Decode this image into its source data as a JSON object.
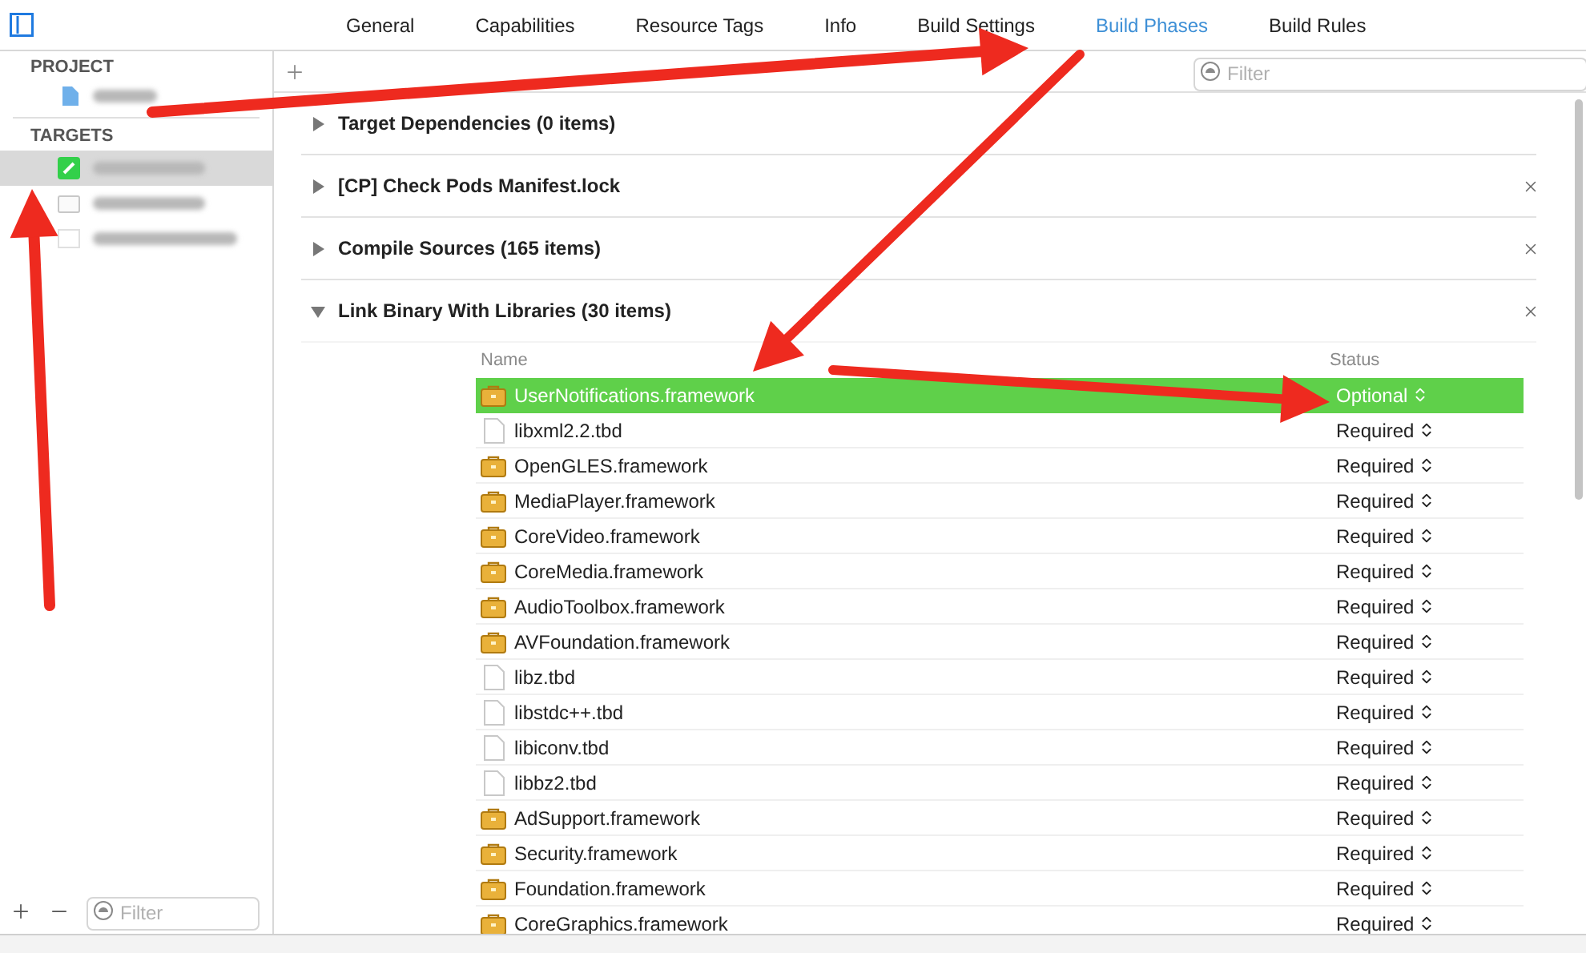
{
  "tabs": [
    {
      "label": "General",
      "selected": false
    },
    {
      "label": "Capabilities",
      "selected": false
    },
    {
      "label": "Resource Tags",
      "selected": false
    },
    {
      "label": "Info",
      "selected": false
    },
    {
      "label": "Build Settings",
      "selected": false
    },
    {
      "label": "Build Phases",
      "selected": true
    },
    {
      "label": "Build Rules",
      "selected": false
    }
  ],
  "sidebar": {
    "project_header": "PROJECT",
    "targets_header": "TARGETS",
    "targets": [
      {
        "selected": true
      },
      {
        "selected": false
      },
      {
        "selected": false
      }
    ],
    "filter": {
      "placeholder": "Filter"
    }
  },
  "filter": {
    "placeholder": "Filter"
  },
  "phases": [
    {
      "title": "Target Dependencies (0 items)",
      "expanded": false,
      "removable": false
    },
    {
      "title": "[CP] Check Pods Manifest.lock",
      "expanded": false,
      "removable": true
    },
    {
      "title": "Compile Sources (165 items)",
      "expanded": false,
      "removable": true
    },
    {
      "title": "Link Binary With Libraries (30 items)",
      "expanded": true,
      "removable": true
    }
  ],
  "libraries": {
    "columns": [
      "Name",
      "Status"
    ],
    "rows": [
      {
        "name": "UserNotifications.framework",
        "kind": "framework",
        "status": "Optional",
        "selected": true
      },
      {
        "name": "libxml2.2.tbd",
        "kind": "tbd",
        "status": "Required",
        "selected": false
      },
      {
        "name": "OpenGLES.framework",
        "kind": "framework",
        "status": "Required",
        "selected": false
      },
      {
        "name": "MediaPlayer.framework",
        "kind": "framework",
        "status": "Required",
        "selected": false
      },
      {
        "name": "CoreVideo.framework",
        "kind": "framework",
        "status": "Required",
        "selected": false
      },
      {
        "name": "CoreMedia.framework",
        "kind": "framework",
        "status": "Required",
        "selected": false
      },
      {
        "name": "AudioToolbox.framework",
        "kind": "framework",
        "status": "Required",
        "selected": false
      },
      {
        "name": "AVFoundation.framework",
        "kind": "framework",
        "status": "Required",
        "selected": false
      },
      {
        "name": "libz.tbd",
        "kind": "tbd",
        "status": "Required",
        "selected": false
      },
      {
        "name": "libstdc++.tbd",
        "kind": "tbd",
        "status": "Required",
        "selected": false
      },
      {
        "name": "libiconv.tbd",
        "kind": "tbd",
        "status": "Required",
        "selected": false
      },
      {
        "name": "libbz2.tbd",
        "kind": "tbd",
        "status": "Required",
        "selected": false
      },
      {
        "name": "AdSupport.framework",
        "kind": "framework",
        "status": "Required",
        "selected": false
      },
      {
        "name": "Security.framework",
        "kind": "framework",
        "status": "Required",
        "selected": false
      },
      {
        "name": "Foundation.framework",
        "kind": "framework",
        "status": "Required",
        "selected": false
      },
      {
        "name": "CoreGraphics.framework",
        "kind": "framework",
        "status": "Required",
        "selected": false
      }
    ]
  }
}
